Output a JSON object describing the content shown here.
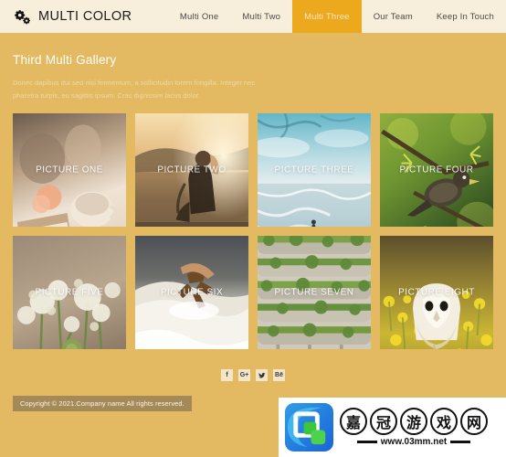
{
  "header": {
    "logo_icon": "cogs-icon",
    "brand": "MULTI COLOR",
    "nav": [
      {
        "label": "Multi One",
        "active": false
      },
      {
        "label": "Multi Two",
        "active": false
      },
      {
        "label": "Multi Three",
        "active": true
      },
      {
        "label": "Our Team",
        "active": false
      },
      {
        "label": "Keep In Touch",
        "active": false
      }
    ],
    "active_bg": "#eda91d",
    "bar_bg": "#f7eedb"
  },
  "main": {
    "title": "Third Multi Gallery",
    "description": "Donec dapibus dui sed nisi fermentum, a sollicitudin lorem fringilla. Integer nec pharetra turpis, eu sagittis ipsum. Cras dignissim lacus dolor.",
    "gallery": [
      {
        "label": "PICTURE ONE",
        "scene": "books-and-teacup"
      },
      {
        "label": "PICTURE TWO",
        "scene": "woman-at-sunset-lake"
      },
      {
        "label": "PICTURE THREE",
        "scene": "ocean-horizon-swimmer"
      },
      {
        "label": "PICTURE FOUR",
        "scene": "bird-on-branch"
      },
      {
        "label": "PICTURE FIVE",
        "scene": "white-flowers"
      },
      {
        "label": "PICTURE SIX",
        "scene": "surfer-in-wave"
      },
      {
        "label": "PICTURE SEVEN",
        "scene": "green-terraced-building"
      },
      {
        "label": "PICTURE EIGHT",
        "scene": "barn-owl-in-yellow-flowers"
      }
    ]
  },
  "footer": {
    "social": [
      {
        "name": "facebook",
        "glyph": "f"
      },
      {
        "name": "google-plus",
        "glyph": "G+"
      },
      {
        "name": "twitter",
        "glyph": ""
      },
      {
        "name": "behance",
        "glyph": "Bē"
      }
    ],
    "copyright": "Copyright © 2021.Company name All rights reserved."
  },
  "watermark": {
    "chars": [
      "嘉",
      "冠",
      "游",
      "戏",
      "网"
    ],
    "url": "www.03mm.net"
  },
  "theme": {
    "body_bg": "#e3ba61",
    "accent": "#eda91d"
  }
}
